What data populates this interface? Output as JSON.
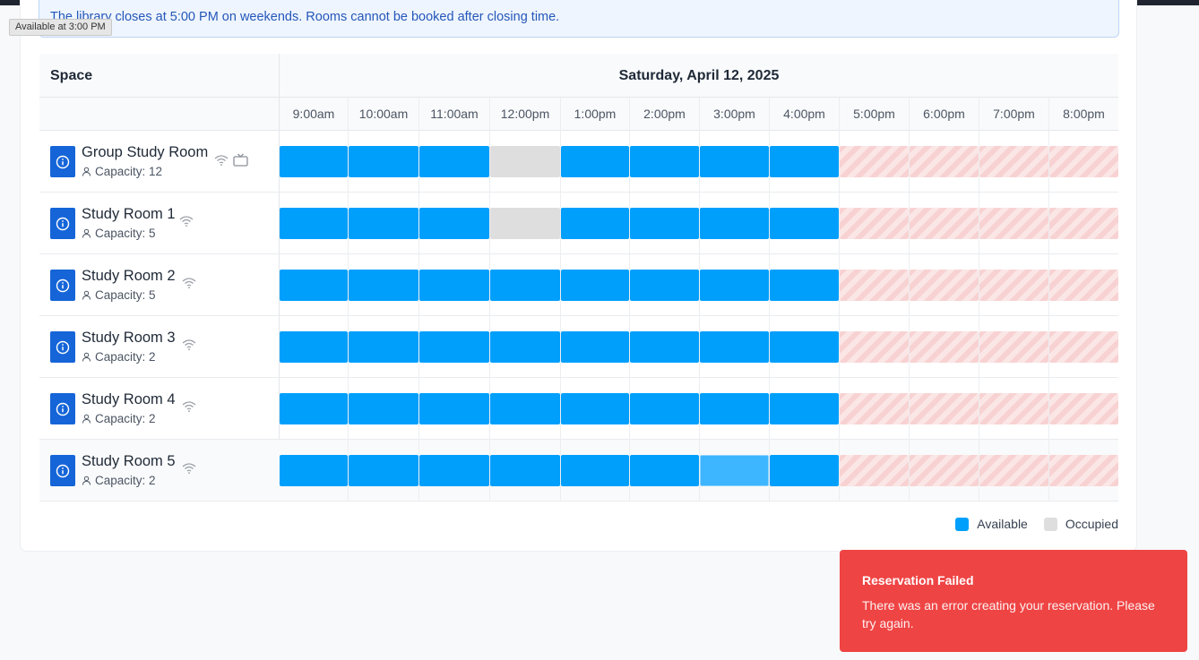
{
  "notice": "The library closes at 5:00 PM on weekends. Rooms cannot be booked after closing time.",
  "tooltip": "Available at 3:00 PM",
  "grid": {
    "space_header": "Space",
    "date_header": "Saturday, April 12, 2025",
    "hours": [
      "9:00am",
      "10:00am",
      "11:00am",
      "12:00pm",
      "1:00pm",
      "2:00pm",
      "3:00pm",
      "4:00pm",
      "5:00pm",
      "6:00pm",
      "7:00pm",
      "8:00pm"
    ],
    "rooms": [
      {
        "name": "Group Study Room",
        "capacity": "Capacity: 12",
        "amenities": [
          "wifi-icon",
          "tv-icon"
        ],
        "slots": [
          "available",
          "available",
          "available",
          "occupied",
          "available",
          "available",
          "available",
          "available",
          "closed",
          "closed",
          "closed",
          "closed"
        ]
      },
      {
        "name": "Study Room 1",
        "capacity": "Capacity: 5",
        "amenities": [
          "wifi-icon"
        ],
        "slots": [
          "available",
          "available",
          "available",
          "occupied",
          "available",
          "available",
          "available",
          "available",
          "closed",
          "closed",
          "closed",
          "closed"
        ]
      },
      {
        "name": "Study Room 2",
        "capacity": "Capacity: 5",
        "amenities": [
          "wifi-icon"
        ],
        "slots": [
          "available",
          "available",
          "available",
          "available",
          "available",
          "available",
          "available",
          "available",
          "closed",
          "closed",
          "closed",
          "closed"
        ]
      },
      {
        "name": "Study Room 3",
        "capacity": "Capacity: 2",
        "amenities": [
          "wifi-icon"
        ],
        "slots": [
          "available",
          "available",
          "available",
          "available",
          "available",
          "available",
          "available",
          "available",
          "closed",
          "closed",
          "closed",
          "closed"
        ]
      },
      {
        "name": "Study Room 4",
        "capacity": "Capacity: 2",
        "amenities": [
          "wifi-icon"
        ],
        "slots": [
          "available",
          "available",
          "available",
          "available",
          "available",
          "available",
          "available",
          "available",
          "closed",
          "closed",
          "closed",
          "closed"
        ]
      },
      {
        "name": "Study Room 5",
        "capacity": "Capacity: 2",
        "amenities": [
          "wifi-icon"
        ],
        "highlighted": true,
        "slots": [
          "available",
          "available",
          "available",
          "available",
          "available",
          "available",
          "hover",
          "available",
          "closed",
          "closed",
          "closed",
          "closed"
        ]
      }
    ]
  },
  "legend": {
    "available": "Available",
    "occupied": "Occupied"
  },
  "colors": {
    "available": "#009ffc",
    "occupied": "#dedede",
    "info_button": "#1565d8",
    "toast": "#ef4444"
  },
  "toast": {
    "title": "Reservation Failed",
    "message": "There was an error creating your reservation. Please try again."
  }
}
